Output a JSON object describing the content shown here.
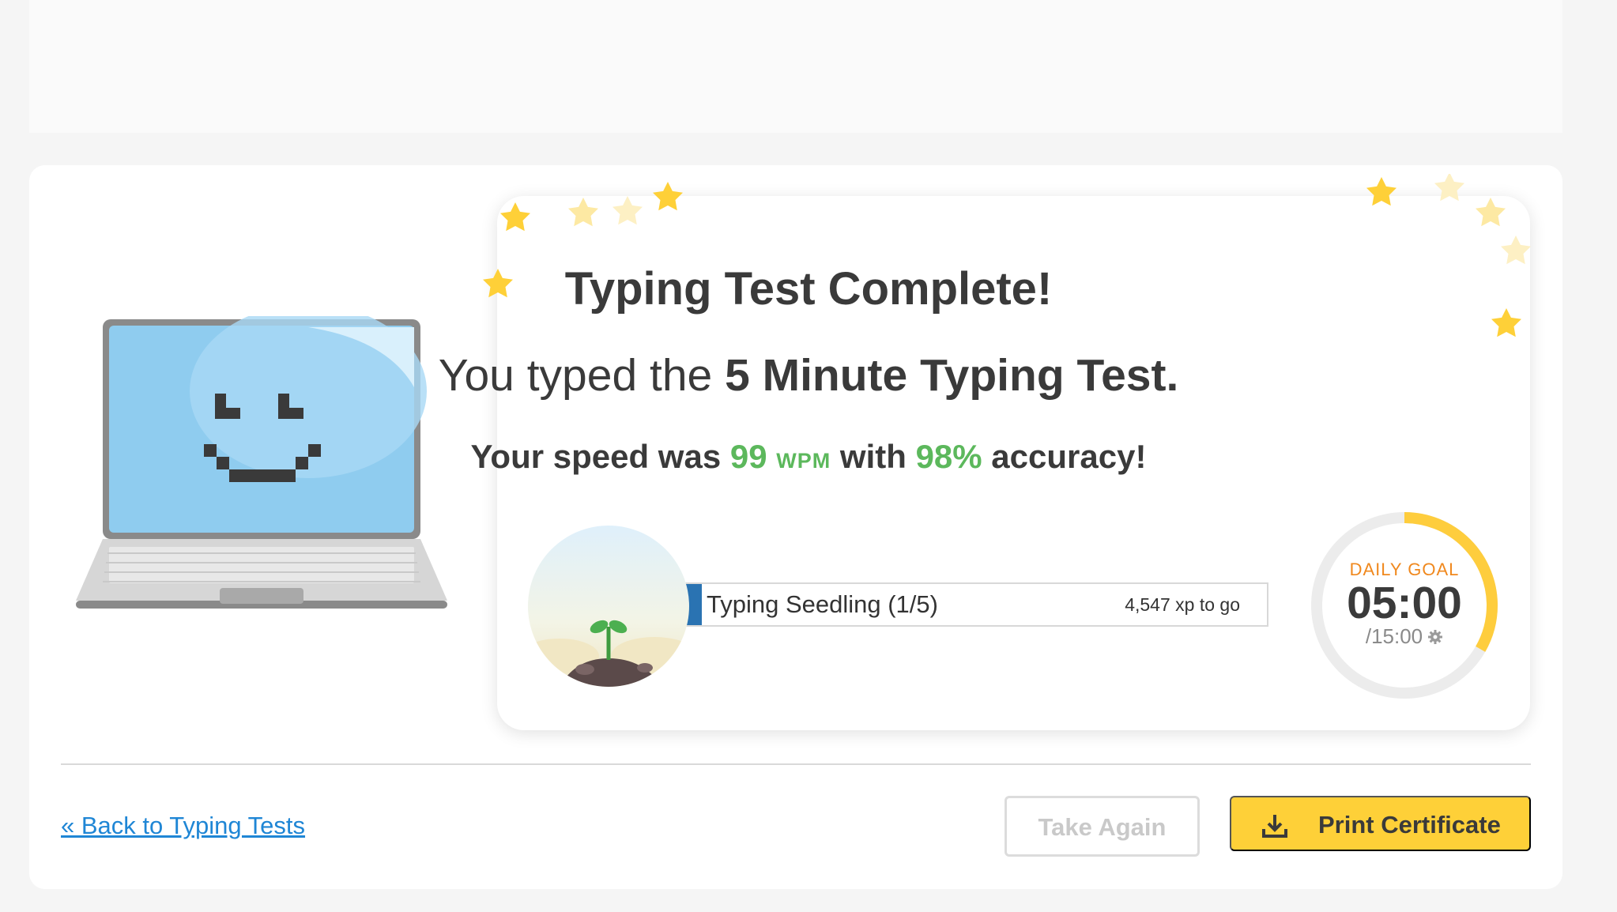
{
  "result": {
    "title": "Typing Test Complete!",
    "subtitle_prefix": "You typed the ",
    "subtitle_test": "5 Minute Typing Test.",
    "speed_prefix": "Your speed was ",
    "wpm": "99",
    "wpm_unit": "WPM",
    "speed_middle": " with ",
    "accuracy": "98%",
    "speed_suffix": " accuracy!"
  },
  "rank": {
    "label": "Typing Seedling (1/5)",
    "xp_to_go": "4,547 xp to go",
    "progress_fraction": 0.03
  },
  "daily_goal": {
    "label": "DAILY GOAL",
    "time": "05:00",
    "total": "/15:00",
    "progress_fraction": 0.333
  },
  "actions": {
    "back_link": "« Back to Typing Tests",
    "take_again": "Take Again",
    "print_certificate": "Print Certificate"
  },
  "colors": {
    "accent_green": "#5cb85c",
    "rank_blue": "#2a73b2",
    "goal_orange": "#f0881d",
    "goal_ring": "#fecd3d",
    "button_yellow": "#fed038",
    "link_blue": "#1f86d5"
  },
  "icons": {
    "download": "download-icon",
    "gear": "gear-icon",
    "star": "star-icon"
  }
}
